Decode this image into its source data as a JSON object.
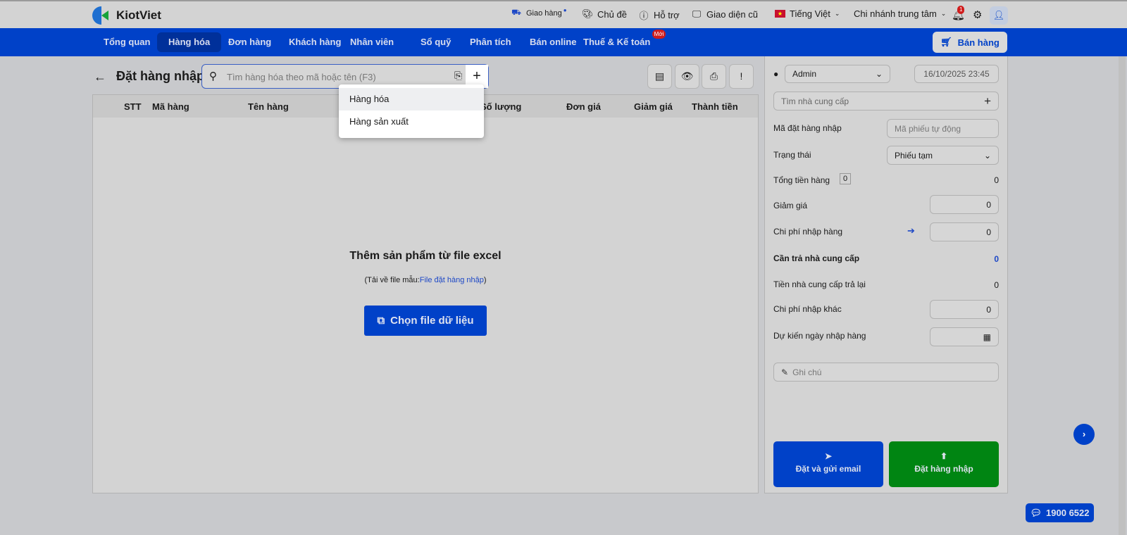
{
  "header": {
    "brand": "KiotViet",
    "delivery": "Giao hàng",
    "theme": "Chủ đề",
    "support": "Hỗ trợ",
    "old_ui": "Giao diện cũ",
    "language": "Tiếng Việt",
    "branch": "Chi nhánh trung tâm",
    "notif_count": "1"
  },
  "nav": {
    "items": [
      "Tổng quan",
      "Hàng hóa",
      "Đơn hàng",
      "Khách hàng",
      "Nhân viên",
      "Sổ quỹ",
      "Phân tích",
      "Bán online",
      "Thuế & Kế toán"
    ],
    "new_badge": "Mới",
    "sell": "Bán hàng"
  },
  "page": {
    "title": "Đặt hàng nhập",
    "search_placeholder": "Tìm hàng hóa theo mã hoặc tên (F3)",
    "tools_info": "!"
  },
  "dropdown": [
    "Hàng hóa",
    "Hàng sản xuất"
  ],
  "table": {
    "columns": [
      "STT",
      "Mã hàng",
      "Tên hàng",
      "Số lượng",
      "Đơn giá",
      "Giảm giá",
      "Thành tiền"
    ]
  },
  "empty": {
    "title": "Thêm sản phẩm từ file excel",
    "sub_prefix": "(Tải về file mẫu:",
    "sub_link": "File đặt hàng nhập",
    "sub_suffix": ")",
    "button": "Chọn file dữ liệu"
  },
  "side": {
    "user": "Admin",
    "datetime": "16/10/2025 23:45",
    "supplier_placeholder": "Tìm nhà cung cấp",
    "code_label": "Mã đặt hàng nhập",
    "code_placeholder": "Mã phiếu tự động",
    "status_label": "Trạng thái",
    "status_value": "Phiếu tạm",
    "total_label": "Tổng tiền hàng",
    "total_count": "0",
    "total_value": "0",
    "discount_label": "Giảm giá",
    "discount_value": "0",
    "import_cost_label": "Chi phí nhập hàng",
    "import_cost_value": "0",
    "payable_label": "Cần trả nhà cung cấp",
    "payable_value": "0",
    "refund_label": "Tiền nhà cung cấp trả lại",
    "refund_value": "0",
    "other_cost_label": "Chi phí nhập khác",
    "other_cost_value": "0",
    "eta_label": "Dự kiến ngày nhập hàng",
    "note_placeholder": "Ghi chú",
    "send_email": "Đặt và gửi email",
    "submit": "Đặt hàng nhập"
  },
  "hotline": "1900 6522"
}
